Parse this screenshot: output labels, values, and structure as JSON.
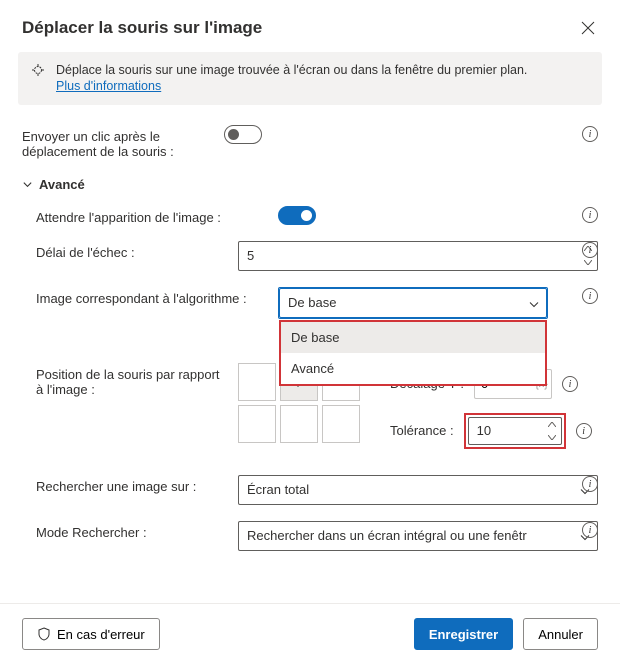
{
  "header": {
    "title": "Déplacer la souris sur l'image"
  },
  "banner": {
    "text": "Déplace la souris sur une image trouvée à l'écran ou dans la fenêtre du premier plan.",
    "link": "Plus d'informations"
  },
  "sendClick": {
    "label": "Envoyer un clic après le déplacement de la souris :",
    "value": false
  },
  "advanced": {
    "title": "Avancé",
    "waitAppear": {
      "label": "Attendre l'apparition de l'image :",
      "value": true
    },
    "failDelay": {
      "label": "Délai de l'échec :",
      "value": "5"
    },
    "algorithm": {
      "label": "Image correspondant à l'algorithme :",
      "selected": "De base",
      "options": [
        "De base",
        "Avancé"
      ]
    },
    "mousePos": {
      "label": "Position de la souris par rapport à l'image :",
      "offsetY": {
        "label": "Décalage Y :",
        "value": "0"
      },
      "tolerance": {
        "label": "Tolérance :",
        "value": "10"
      }
    },
    "searchOn": {
      "label": "Rechercher une image sur :",
      "value": "Écran total"
    },
    "searchMode": {
      "label": "Mode Rechercher :",
      "value": "Rechercher dans un écran intégral ou une fenêtr"
    }
  },
  "footer": {
    "onError": "En cas d'erreur",
    "save": "Enregistrer",
    "cancel": "Annuler"
  }
}
